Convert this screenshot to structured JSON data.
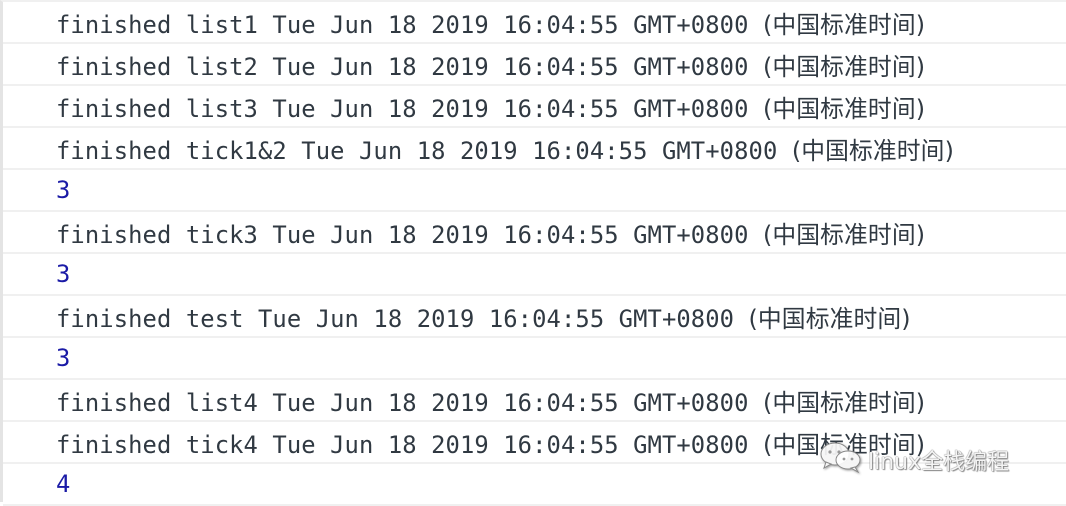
{
  "console": {
    "entries": [
      {
        "type": "log",
        "label": "finished list1",
        "datetime": "Tue Jun 18 2019 16:04:55 GMT+0800",
        "tz": "(中国标准时间)"
      },
      {
        "type": "log",
        "label": "finished list2",
        "datetime": "Tue Jun 18 2019 16:04:55 GMT+0800",
        "tz": "(中国标准时间)"
      },
      {
        "type": "log",
        "label": "finished list3",
        "datetime": "Tue Jun 18 2019 16:04:55 GMT+0800",
        "tz": "(中国标准时间)"
      },
      {
        "type": "log",
        "label": "finished tick1&2",
        "datetime": "Tue Jun 18 2019 16:04:55 GMT+0800",
        "tz": "(中国标准时间)"
      },
      {
        "type": "number",
        "value": "3"
      },
      {
        "type": "log",
        "label": "finished tick3",
        "datetime": "Tue Jun 18 2019 16:04:55 GMT+0800",
        "tz": "(中国标准时间)"
      },
      {
        "type": "number",
        "value": "3"
      },
      {
        "type": "log",
        "label": "finished test",
        "datetime": "Tue Jun 18 2019 16:04:55 GMT+0800",
        "tz": "(中国标准时间)"
      },
      {
        "type": "number",
        "value": "3"
      },
      {
        "type": "log",
        "label": "finished list4",
        "datetime": "Tue Jun 18 2019 16:04:55 GMT+0800",
        "tz": "(中国标准时间)"
      },
      {
        "type": "log",
        "label": "finished tick4",
        "datetime": "Tue Jun 18 2019 16:04:55 GMT+0800",
        "tz": "(中国标准时间)"
      },
      {
        "type": "number",
        "value": "4"
      }
    ]
  },
  "watermark": {
    "icon": "wechat-icon",
    "text": "linux全栈编程"
  },
  "colors": {
    "text": "#303942",
    "number": "#1a1aa6",
    "separator": "#f0f0f0"
  }
}
